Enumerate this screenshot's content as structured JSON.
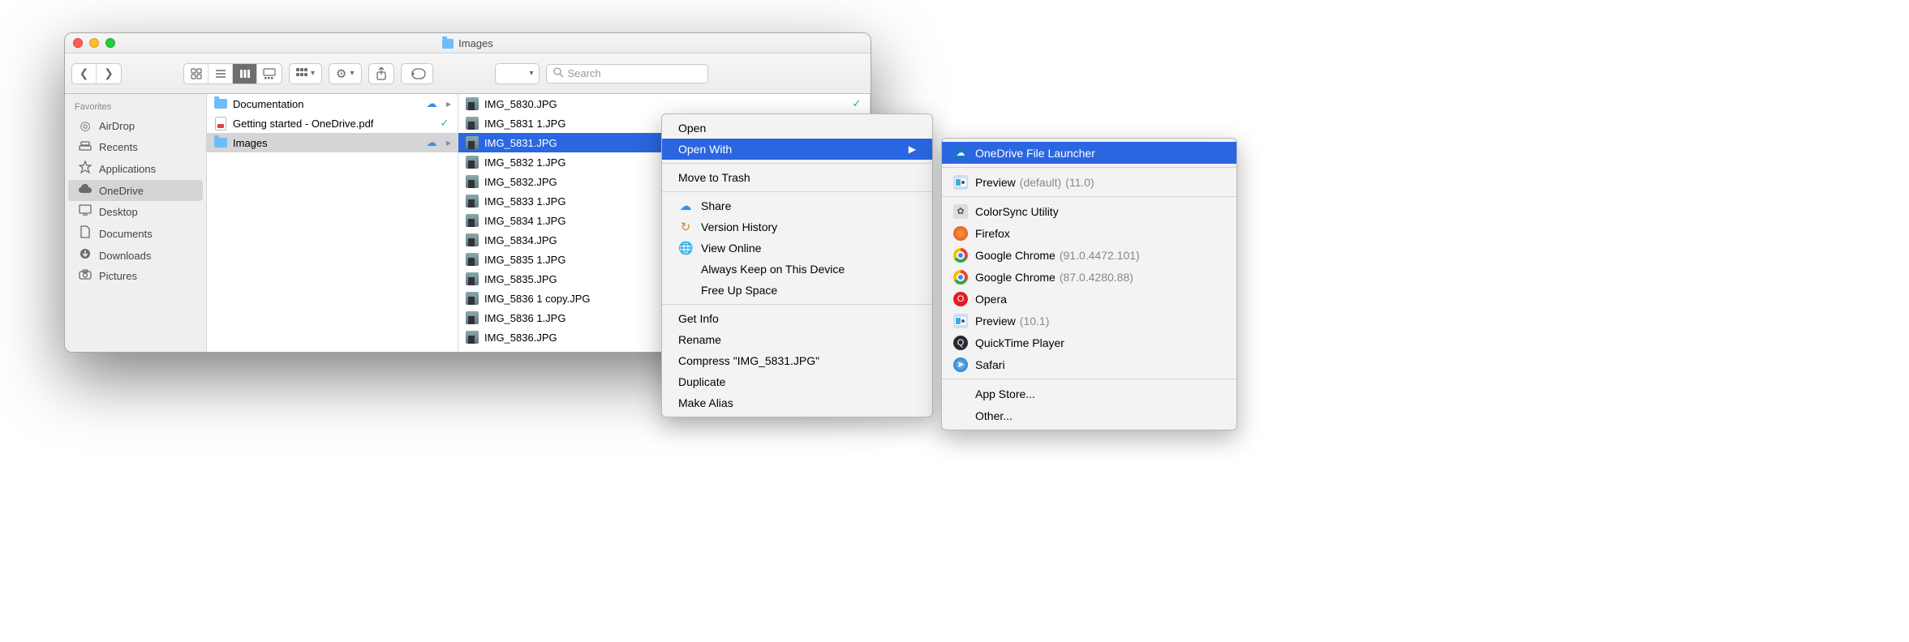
{
  "window": {
    "title": "Images"
  },
  "search": {
    "placeholder": "Search"
  },
  "sidebar": {
    "header": "Favorites",
    "items": [
      {
        "label": "AirDrop",
        "icon": "airdrop"
      },
      {
        "label": "Recents",
        "icon": "recents"
      },
      {
        "label": "Applications",
        "icon": "applications"
      },
      {
        "label": "OneDrive",
        "icon": "cloud"
      },
      {
        "label": "Desktop",
        "icon": "desktop"
      },
      {
        "label": "Documents",
        "icon": "documents"
      },
      {
        "label": "Downloads",
        "icon": "downloads"
      },
      {
        "label": "Pictures",
        "icon": "pictures"
      }
    ],
    "selected": "OneDrive"
  },
  "col1": [
    {
      "name": "Documentation",
      "type": "folder",
      "status": "cloud",
      "arrow": true
    },
    {
      "name": "Getting started - OneDrive.pdf",
      "type": "pdf",
      "status": "check"
    },
    {
      "name": "Images",
      "type": "folder",
      "status": "cloud",
      "arrow": true,
      "selected": true
    }
  ],
  "col2": [
    {
      "name": "IMG_5830.JPG",
      "status": "check"
    },
    {
      "name": "IMG_5831 1.JPG",
      "status": "cloud"
    },
    {
      "name": "IMG_5831.JPG",
      "status": "cloud-white",
      "selected": true
    },
    {
      "name": "IMG_5832 1.JPG",
      "status": "check"
    },
    {
      "name": "IMG_5832.JPG",
      "status": "cloud"
    },
    {
      "name": "IMG_5833 1.JPG",
      "status": "check"
    },
    {
      "name": "IMG_5834 1.JPG",
      "status": "check"
    },
    {
      "name": "IMG_5834.JPG",
      "status": "check"
    },
    {
      "name": "IMG_5835 1.JPG",
      "status": "check"
    },
    {
      "name": "IMG_5835.JPG",
      "status": "check"
    },
    {
      "name": "IMG_5836 1 copy.JPG",
      "status": "check"
    },
    {
      "name": "IMG_5836 1.JPG",
      "status": "check"
    },
    {
      "name": "IMG_5836.JPG",
      "status": "check"
    }
  ],
  "context_menu": {
    "open": "Open",
    "open_with": "Open With",
    "move_to_trash": "Move to Trash",
    "share": "Share",
    "version_history": "Version History",
    "view_online": "View Online",
    "always_keep": "Always Keep on This Device",
    "free_up": "Free Up Space",
    "get_info": "Get Info",
    "rename": "Rename",
    "compress": "Compress \"IMG_5831.JPG\"",
    "duplicate": "Duplicate",
    "make_alias": "Make Alias"
  },
  "open_with_menu": {
    "onedrive_launcher": "OneDrive File Launcher",
    "preview_default": {
      "label": "Preview",
      "suffix1": "(default)",
      "suffix2": "(11.0)"
    },
    "colorsync": "ColorSync Utility",
    "firefox": "Firefox",
    "chrome1": {
      "label": "Google Chrome",
      "suffix": "(91.0.4472.101)"
    },
    "chrome2": {
      "label": "Google Chrome",
      "suffix": "(87.0.4280.88)"
    },
    "opera": "Opera",
    "preview2": {
      "label": "Preview",
      "suffix": "(10.1)"
    },
    "quicktime": "QuickTime Player",
    "safari": "Safari",
    "app_store": "App Store...",
    "other": "Other..."
  }
}
